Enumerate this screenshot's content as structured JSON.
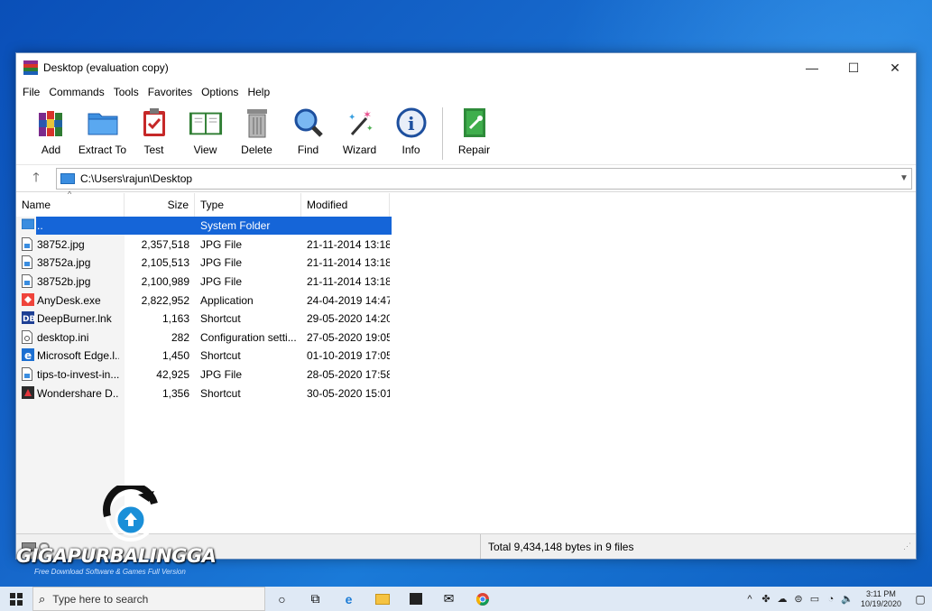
{
  "window": {
    "title": "Desktop (evaluation copy)",
    "controls": {
      "minimize": "—",
      "maximize": "☐",
      "close": "✕"
    }
  },
  "menu": [
    "File",
    "Commands",
    "Tools",
    "Favorites",
    "Options",
    "Help"
  ],
  "toolbar": [
    {
      "label": "Add",
      "icon": "books-icon"
    },
    {
      "label": "Extract To",
      "icon": "folder-icon"
    },
    {
      "label": "Test",
      "icon": "clipboard-check-icon"
    },
    {
      "label": "View",
      "icon": "book-open-icon"
    },
    {
      "label": "Delete",
      "icon": "trash-icon"
    },
    {
      "label": "Find",
      "icon": "magnifier-icon"
    },
    {
      "label": "Wizard",
      "icon": "magic-wand-icon"
    },
    {
      "label": "Info",
      "icon": "info-icon"
    },
    {
      "label": "Repair",
      "icon": "repair-box-icon"
    }
  ],
  "address": {
    "path": "C:\\Users\\rajun\\Desktop"
  },
  "columns": {
    "name": "Name",
    "size": "Size",
    "type": "Type",
    "modified": "Modified"
  },
  "files": [
    {
      "name": "..",
      "size": "",
      "type": "System Folder",
      "modified": "",
      "icon": "folder",
      "selected": true
    },
    {
      "name": "38752.jpg",
      "size": "2,357,518",
      "type": "JPG File",
      "modified": "21-11-2014 13:18",
      "icon": "image"
    },
    {
      "name": "38752a.jpg",
      "size": "2,105,513",
      "type": "JPG File",
      "modified": "21-11-2014 13:18",
      "icon": "image"
    },
    {
      "name": "38752b.jpg",
      "size": "2,100,989",
      "type": "JPG File",
      "modified": "21-11-2014 13:18",
      "icon": "image"
    },
    {
      "name": "AnyDesk.exe",
      "size": "2,822,952",
      "type": "Application",
      "modified": "24-04-2019 14:47",
      "icon": "anydesk"
    },
    {
      "name": "DeepBurner.lnk",
      "size": "1,163",
      "type": "Shortcut",
      "modified": "29-05-2020 14:20",
      "icon": "deepburner"
    },
    {
      "name": "desktop.ini",
      "size": "282",
      "type": "Configuration setti...",
      "modified": "27-05-2020 19:05",
      "icon": "config"
    },
    {
      "name": "Microsoft Edge.l...",
      "size": "1,450",
      "type": "Shortcut",
      "modified": "01-10-2019 17:05",
      "icon": "edge"
    },
    {
      "name": "tips-to-invest-in...",
      "size": "42,925",
      "type": "JPG File",
      "modified": "28-05-2020 17:58",
      "icon": "image"
    },
    {
      "name": "Wondershare D...",
      "size": "1,356",
      "type": "Shortcut",
      "modified": "30-05-2020 15:01",
      "icon": "wondershare"
    }
  ],
  "status": {
    "text": "Total 9,434,148 bytes in 9 files"
  },
  "watermark": {
    "brand": "GIGAPURBALINGGA",
    "tagline": "Free Download Software & Games Full Version"
  },
  "taskbar": {
    "search_placeholder": "Type here to search",
    "time": "3:11 PM",
    "date": "10/19/2020"
  },
  "colors": {
    "selection": "#1565d8",
    "desktop": "#1565c9"
  }
}
